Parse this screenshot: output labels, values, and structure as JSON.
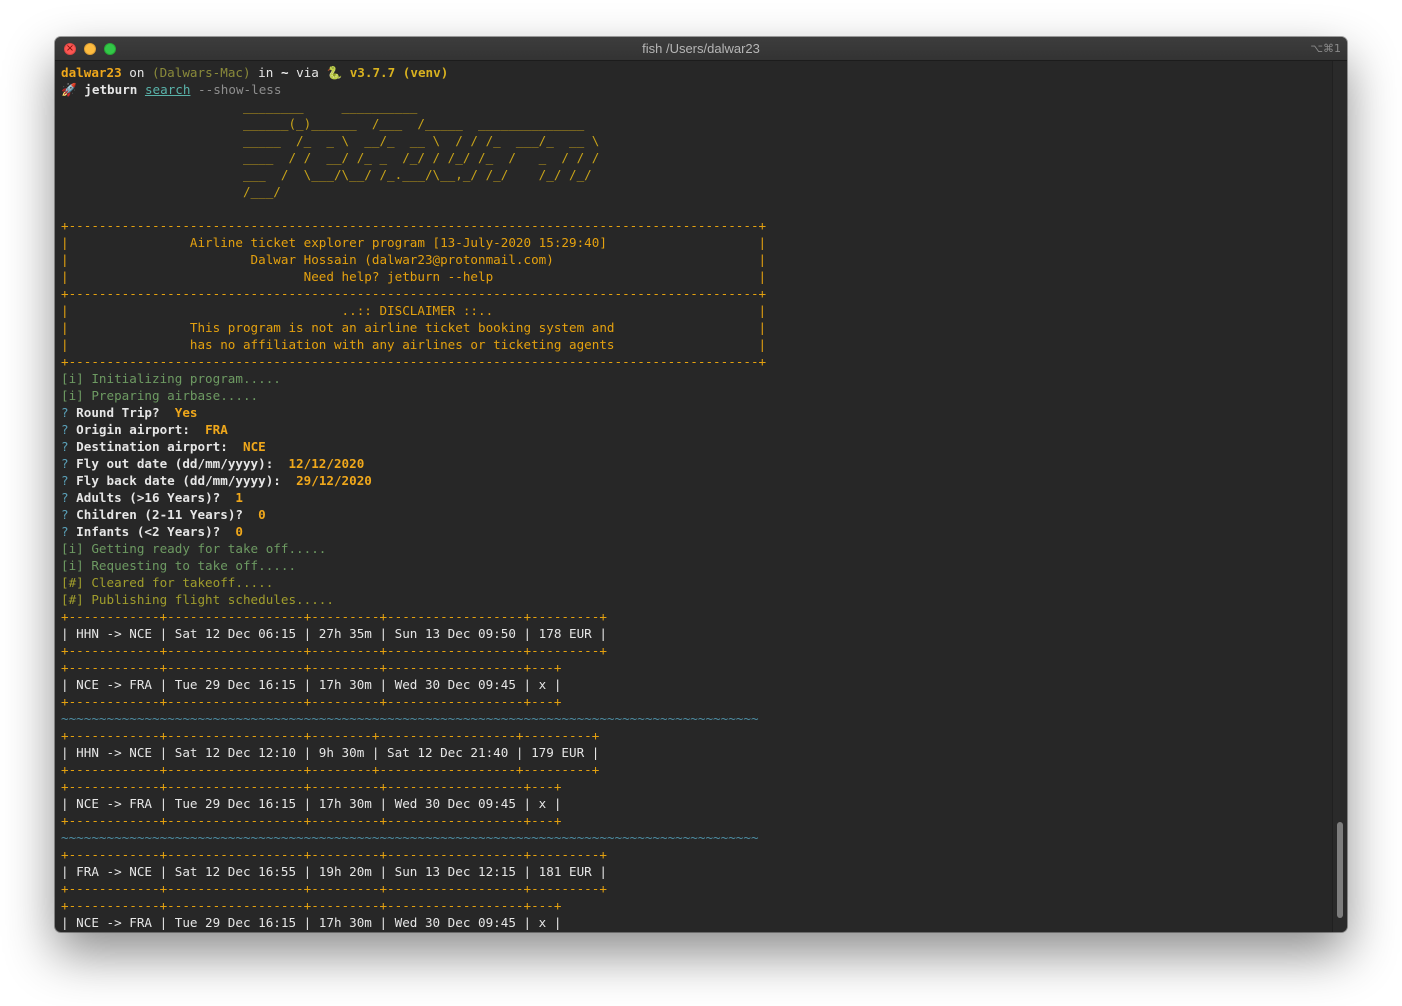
{
  "window": {
    "title": "fish /Users/dalwar23",
    "shortcut": "⌥⌘1",
    "close_glyph": "×"
  },
  "prompt": {
    "user": "dalwar23",
    "on": " on ",
    "host": "(Dalwars-Mac)",
    "in": " in ",
    "cwd": "~",
    "via": " via ",
    "python_icon": "🐍",
    "version": " v3.7.7 (venv)",
    "rocket_icon": "🚀",
    "command": "jetburn",
    "subcommand": "search",
    "flag": " --show-less"
  },
  "banner_art": [
    "                        ________     __________",
    "                        ______(_)______  /___  /_____  ______________",
    "                        _____  /_  _ \\  __/_  __ \\  / / /_  ___/_  __ \\",
    "                        ____  / /  __/ /_ _  /_/ / /_/ /_  /   _  / / /",
    "                        ___  /  \\___/\\__/ /_.___/\\__,_/ /_/    /_/ /_/",
    "                        /___/"
  ],
  "header_box": {
    "border": "+-------------------------------------------------------------------------------------------+",
    "rows": [
      "|                Airline ticket explorer program [13-July-2020 15:29:40]                    |",
      "|                        Dalwar Hossain (dalwar23@protonmail.com)                           |",
      "|                               Need help? jetburn --help                                   |"
    ],
    "disclaimer": [
      "|                                    ..:: DISCLAIMER ::..                                   |",
      "|                This program is not an airline ticket booking system and                   |",
      "|                has no affiliation with any airlines or ticketing agents                   |"
    ]
  },
  "log_start": [
    "[i] Initializing program.....",
    "[i] Preparing airbase....."
  ],
  "questions": [
    {
      "mark": "? ",
      "label": "Round Trip? ",
      "answer": " Yes"
    },
    {
      "mark": "? ",
      "label": "Origin airport: ",
      "answer": " FRA"
    },
    {
      "mark": "? ",
      "label": "Destination airport: ",
      "answer": " NCE"
    },
    {
      "mark": "? ",
      "label": "Fly out date (dd/mm/yyyy): ",
      "answer": " 12/12/2020"
    },
    {
      "mark": "? ",
      "label": "Fly back date (dd/mm/yyyy): ",
      "answer": " 29/12/2020"
    },
    {
      "mark": "? ",
      "label": "Adults (>16 Years)? ",
      "answer": " 1"
    },
    {
      "mark": "? ",
      "label": "Children (2-11 Years)? ",
      "answer": " 0"
    },
    {
      "mark": "? ",
      "label": "Infants (<2 Years)? ",
      "answer": " 0"
    }
  ],
  "log_after": [
    "[i] Getting ready for take off.....",
    "[i] Requesting to take off....."
  ],
  "log_cleared": [
    "[#] Cleared for takeoff.....",
    "[#] Publishing flight schedules....."
  ],
  "results": {
    "separator": "~~~~~~~~~~~~~~~~~~~~~~~~~~~~~~~~~~~~~~~~~~~~~~~~~~~~~~~~~~~~~~~~~~~~~~~~~~~~~~~~~~~~~~~~~~~~",
    "groups": [
      {
        "out_border": "+------------+------------------+---------+------------------+---------+",
        "out_row": "| HHN -> NCE | Sat 12 Dec 06:15 | 27h 35m | Sun 13 Dec 09:50 | 178 EUR |",
        "back_border": "+------------+------------------+---------+------------------+---+",
        "back_row": "| NCE -> FRA | Tue 29 Dec 16:15 | 17h 30m | Wed 30 Dec 09:45 | x |"
      },
      {
        "out_border": "+------------+------------------+--------+------------------+---------+",
        "out_row": "| HHN -> NCE | Sat 12 Dec 12:10 | 9h 30m | Sat 12 Dec 21:40 | 179 EUR |",
        "back_border": "+------------+------------------+---------+------------------+---+",
        "back_row": "| NCE -> FRA | Tue 29 Dec 16:15 | 17h 30m | Wed 30 Dec 09:45 | x |"
      },
      {
        "out_border": "+------------+------------------+---------+------------------+---------+",
        "out_row": "| FRA -> NCE | Sat 12 Dec 16:55 | 19h 20m | Sun 13 Dec 12:15 | 181 EUR |",
        "back_border": "+------------+------------------+---------+------------------+---+",
        "back_row": "| NCE -> FRA | Tue 29 Dec 16:15 | 17h 30m | Wed 30 Dec 09:45 | x |"
      }
    ]
  },
  "colors": {
    "terminal_bg": "#272727",
    "yellow": "#e4a10f",
    "green": "#6d9a62",
    "olive": "#a09d2c",
    "cyan": "#4d8ea4"
  }
}
